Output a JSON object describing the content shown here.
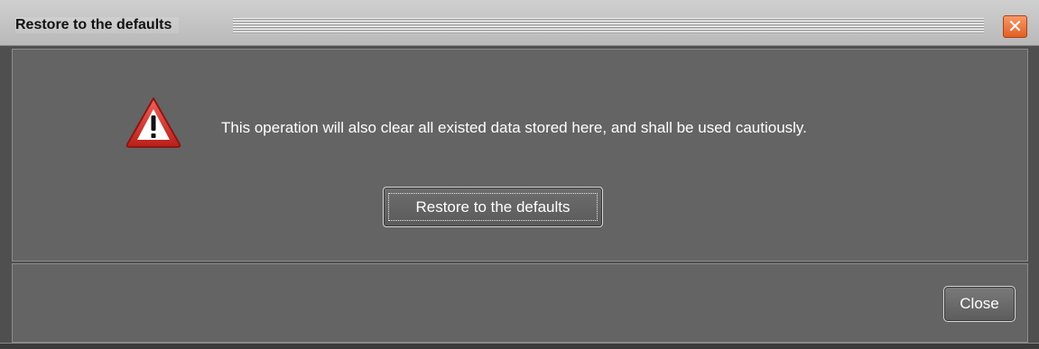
{
  "window": {
    "title": "Restore to the defaults",
    "close_icon": "close-icon",
    "close_glyph": "✕",
    "accent_close": "#e25f24"
  },
  "content": {
    "warning_icon": "warning-triangle-icon",
    "message": "This operation will also clear all existed data stored here, and shall be used cautiously.",
    "restore_button_label": "Restore to the defaults"
  },
  "footer": {
    "close_button_label": "Close"
  },
  "colors": {
    "panel_bg": "#646464",
    "window_bg": "#4f4f4f",
    "text": "#ffffff",
    "warning_red": "#d0342c"
  }
}
